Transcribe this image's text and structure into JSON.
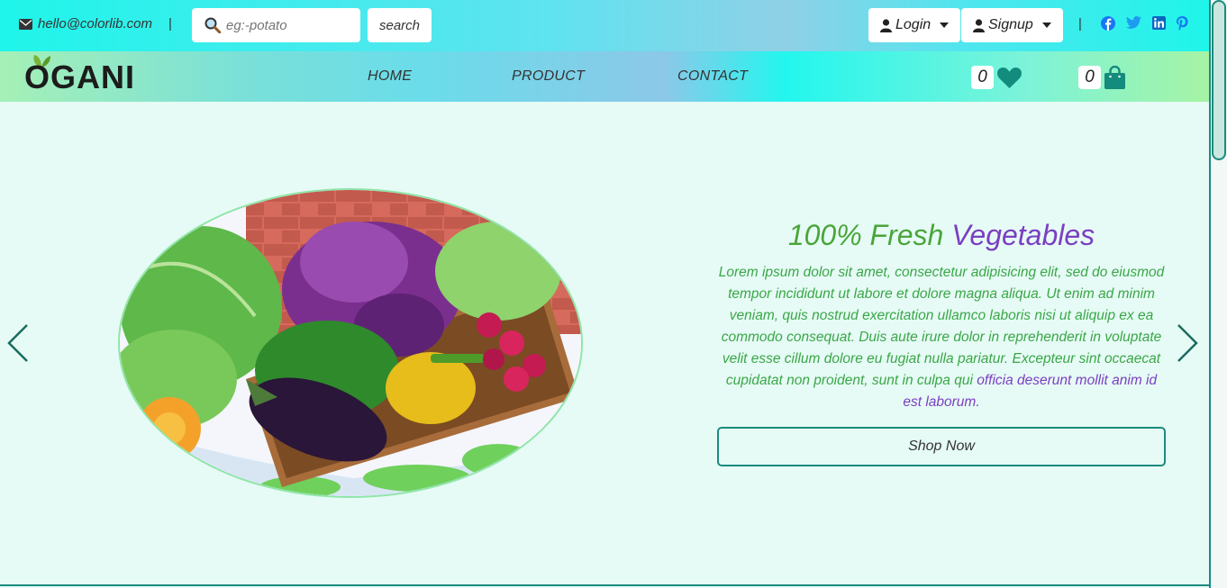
{
  "topbar": {
    "email": "hello@colorlib.com",
    "separator": "|",
    "search_placeholder": "eg:-potato",
    "search_button": "search",
    "login_label": "Login",
    "signup_label": "Signup",
    "social_icons": [
      "facebook-icon",
      "twitter-icon",
      "linkedin-icon",
      "pinterest-icon"
    ]
  },
  "navbar": {
    "logo": "OGANI",
    "links": [
      "HOME",
      "PRODUCT",
      "CONTACT"
    ],
    "wishlist_count": "0",
    "cart_count": "0"
  },
  "hero": {
    "title_part1": "100% Fresh ",
    "title_part2": "Vegetables",
    "text_part1": "Lorem ipsum dolor sit amet, consectetur adipisicing elit, sed do eiusmod tempor incididunt ut labore et dolore magna aliqua. Ut enim ad minim veniam, quis nostrud exercitation ullamco laboris nisi ut aliquip ex ea commodo consequat. Duis aute irure dolor in reprehenderit in voluptate velit esse cillum dolore eu fugiat nulla pariatur. Excepteur sint occaecat cupidatat non proident, sunt in culpa qui ",
    "text_part2": "officia deserunt mollit anim id est laborum.",
    "button_label": "Shop Now"
  },
  "colors": {
    "accent": "#1b8b7e",
    "title_green": "#4aa53a",
    "title_purple": "#7a3fc2",
    "hero_bg": "#e6fbf5"
  }
}
